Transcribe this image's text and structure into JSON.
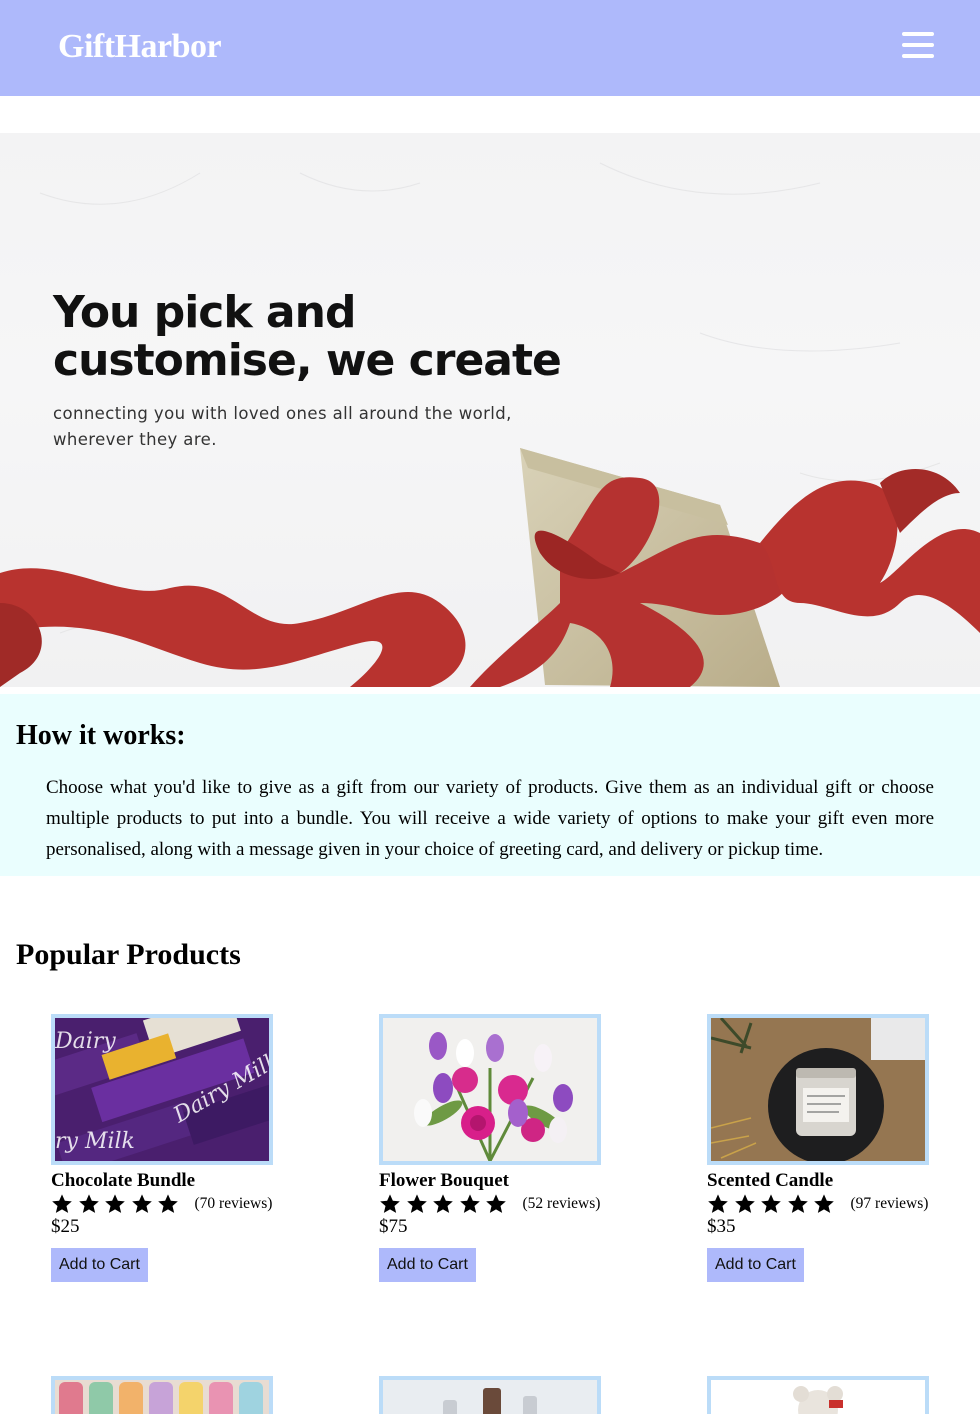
{
  "nav": {
    "logo": "GiftHarbor",
    "menu_icon": "hamburger-menu-icon"
  },
  "hero": {
    "title": "You pick and customise, we create",
    "subtitle": "connecting you with loved ones all around the world, wherever they are."
  },
  "how_it_works": {
    "heading": "How it works:",
    "body": "Choose what you'd like to give as a gift from our variety of products. Give them as an individual gift or choose multiple products to put into a bundle. You will receive a wide variety of options to make your gift even more personalised, along with a message given in your choice of greeting card, and delivery or pickup time."
  },
  "popular": {
    "heading": "Popular Products",
    "products": [
      {
        "name": "Chocolate Bundle",
        "rating": 5,
        "reviews": "(70 reviews)",
        "price": "$25",
        "button": "Add to Cart"
      },
      {
        "name": "Flower Bouquet",
        "rating": 5,
        "reviews": "(52 reviews)",
        "price": "$75",
        "button": "Add to Cart"
      },
      {
        "name": "Scented Candle",
        "rating": 5,
        "reviews": "(97 reviews)",
        "price": "$35",
        "button": "Add to Cart"
      }
    ]
  },
  "colors": {
    "nav_bg": "#aeb9fb",
    "how_bg": "#eafefe",
    "thumb_border": "#bbdcf8",
    "button_bg": "#aeb9fb"
  }
}
